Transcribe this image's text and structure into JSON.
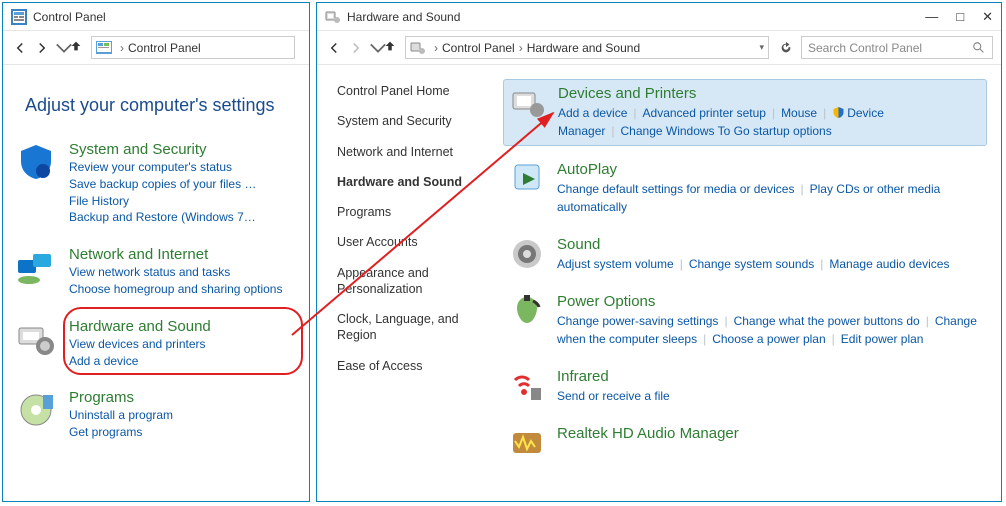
{
  "left": {
    "title": "Control Panel",
    "breadcrumb": [
      "Control Panel"
    ],
    "heading": "Adjust your computer's settings",
    "items": [
      {
        "title": "System and Security",
        "links": [
          "Review your computer's status",
          "Save backup copies of your files …",
          "File History",
          "Backup and Restore (Windows 7…"
        ]
      },
      {
        "title": "Network and Internet",
        "links": [
          "View network status and tasks",
          "Choose homegroup and sharing options"
        ]
      },
      {
        "title": "Hardware and Sound",
        "links": [
          "View devices and printers",
          "Add a device"
        ]
      },
      {
        "title": "Programs",
        "links": [
          "Uninstall a program",
          "Get programs"
        ]
      }
    ]
  },
  "right": {
    "title": "Hardware and Sound",
    "breadcrumb": [
      "Control Panel",
      "Hardware and Sound"
    ],
    "search_placeholder": "Search Control Panel",
    "side": [
      "Control Panel Home",
      "System and Security",
      "Network and Internet",
      "Hardware and Sound",
      "Programs",
      "User Accounts",
      "Appearance and Personalization",
      "Clock, Language, and Region",
      "Ease of Access"
    ],
    "side_current": "Hardware and Sound",
    "blocks": [
      {
        "title": "Devices and Printers",
        "links": [
          "Add a device",
          "Advanced printer setup",
          "Mouse",
          "Device Manager",
          "Change Windows To Go startup options"
        ],
        "shield_index": 3
      },
      {
        "title": "AutoPlay",
        "links": [
          "Change default settings for media or devices",
          "Play CDs or other media automatically"
        ]
      },
      {
        "title": "Sound",
        "links": [
          "Adjust system volume",
          "Change system sounds",
          "Manage audio devices"
        ]
      },
      {
        "title": "Power Options",
        "links": [
          "Change power-saving settings",
          "Change what the power buttons do",
          "Change when the computer sleeps",
          "Choose a power plan",
          "Edit power plan"
        ]
      },
      {
        "title": "Infrared",
        "links": [
          "Send or receive a file"
        ]
      },
      {
        "title": "Realtek HD Audio Manager",
        "links": []
      }
    ],
    "selected_block": 0,
    "win_buttons": {
      "min": "—",
      "max": "□",
      "close": "✕"
    }
  }
}
